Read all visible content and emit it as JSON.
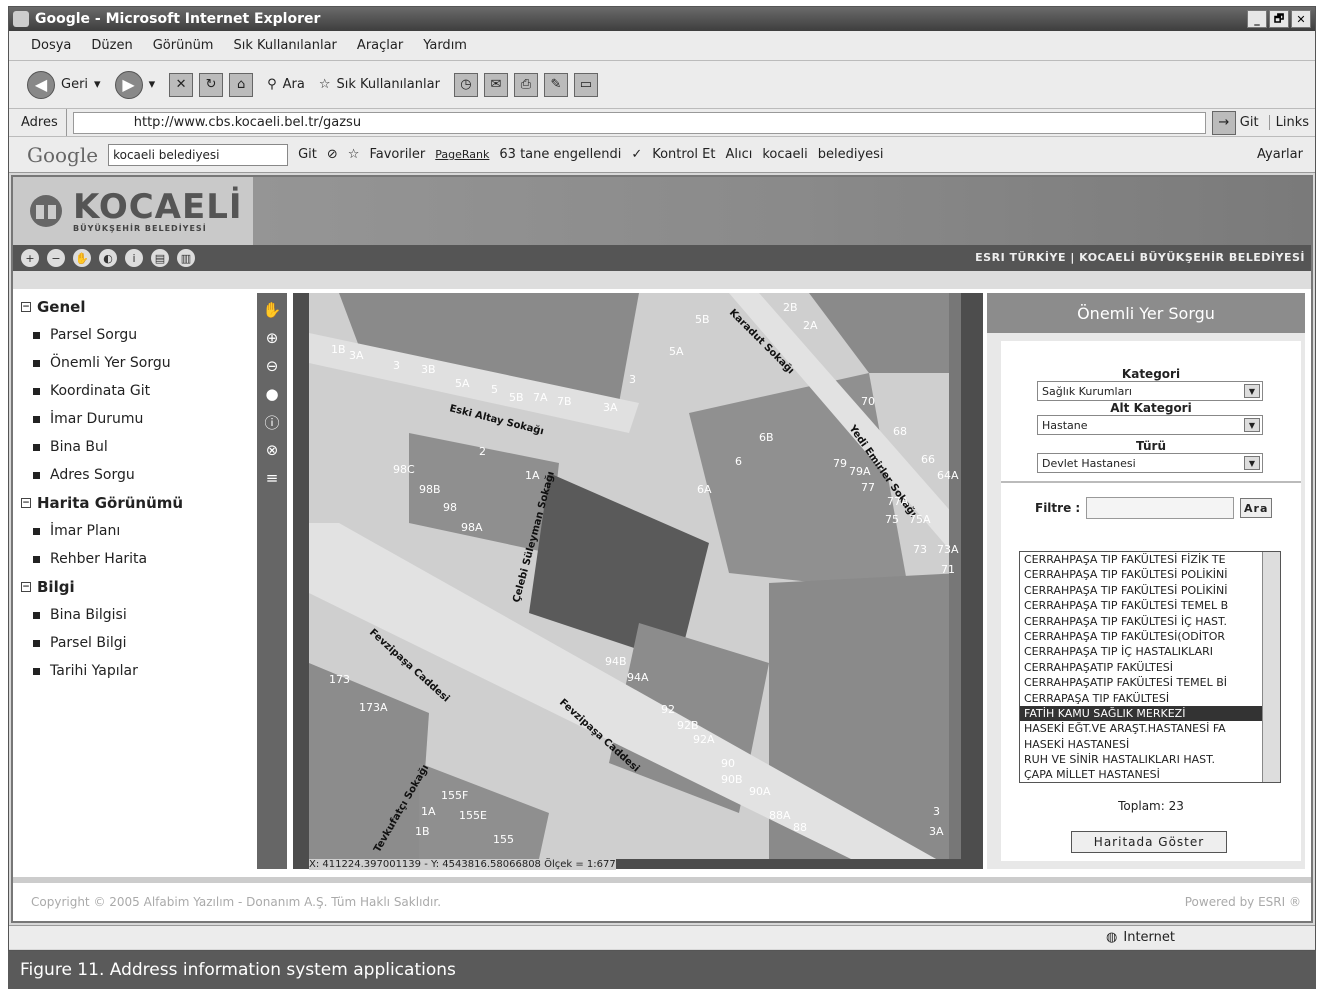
{
  "window": {
    "title": "Google - Microsoft Internet Explorer",
    "controls": [
      "_",
      "🗗",
      "✕"
    ]
  },
  "menu": [
    "Dosya",
    "Düzen",
    "Görünüm",
    "Sık Kullanılanlar",
    "Araçlar",
    "Yardım"
  ],
  "toolbar": {
    "back": "Geri",
    "search": "Ara",
    "favorites": "Sık Kullanılanlar"
  },
  "address": {
    "label": "Adres",
    "url": "http://www.cbs.kocaeli.bel.tr/gazsu",
    "go": "Git",
    "links": "Links"
  },
  "googlebar": {
    "brand": "Google",
    "query": "kocaeli belediyesi",
    "go": "Git",
    "favoriler": "Favoriler",
    "pagerank": "PageRank",
    "blocked": "63 tane engellendi",
    "spell": "Kontrol Et",
    "send": "Alıcı",
    "term1": "kocaeli",
    "term2": "belediyesi",
    "settings": "Ayarlar"
  },
  "site": {
    "logo": "KOCAELİ",
    "logo_sub": "BÜYÜKŞEHİR BELEDİYESİ",
    "credit": "ESRI TÜRKİYE | KOCAELİ BÜYÜKŞEHİR BELEDİYESİ"
  },
  "nav": {
    "genel": "Genel",
    "genel_items": [
      "Parsel Sorgu",
      "Önemli Yer Sorgu",
      "Koordinata Git",
      "İmar Durumu",
      "Bina Bul",
      "Adres Sorgu"
    ],
    "harita": "Harita Görünümü",
    "harita_items": [
      "İmar Planı",
      "Rehber Harita"
    ],
    "bilgi": "Bilgi",
    "bilgi_items": [
      "Bina Bilgisi",
      "Parsel Bilgi",
      "Tarihi Yapılar"
    ]
  },
  "map": {
    "streets": [
      "Karadut Sokağı",
      "Eski Altay Sokağı",
      "Yedi Emirler Sokağı",
      "Çelebi Süleyman Sokağı",
      "Fevzipaşa Caddesi",
      "Fevzipaşa Caddesi",
      "Tevkufatçı Sokağı"
    ],
    "labels": [
      "1B",
      "3A",
      "3",
      "3B",
      "5A",
      "5",
      "5B",
      "7A",
      "7B",
      "3A",
      "3",
      "5B",
      "5A",
      "2B",
      "2A",
      "2",
      "1A",
      "98C",
      "98B",
      "98",
      "98A",
      "6B",
      "6",
      "6A",
      "70",
      "68",
      "66",
      "64A",
      "79",
      "79A",
      "77",
      "77A",
      "75",
      "75A",
      "73",
      "73A",
      "71",
      "94B",
      "94A",
      "92",
      "92B",
      "92A",
      "90",
      "90B",
      "90A",
      "88A",
      "88",
      "173",
      "173A",
      "155F",
      "1A",
      "155E",
      "1B",
      "155",
      "3",
      "3A"
    ],
    "coords": "X: 411224.397001139 - Y: 4543816.58066808 Ölçek = 1:677"
  },
  "query": {
    "title": "Önemli Yer Sorgu",
    "kategori_label": "Kategori",
    "kategori": "Sağlık Kurumları",
    "alt_label": "Alt Kategori",
    "alt": "Hastane",
    "turu_label": "Türü",
    "turu": "Devlet Hastanesi",
    "filtre_label": "Filtre :",
    "ara": "Ara",
    "results": [
      "CERRAHPAŞA TIP FAKÜLTESİ FİZİK TE",
      "CERRAHPAŞA TIP FAKÜLTESİ POLİKİNİ",
      "CERRAHPAŞA TIP FAKÜLTESİ POLİKİNİ",
      "CERRAHPAŞA TIP FAKÜLTESİ TEMEL B",
      "CERRAHPAŞA TIP FAKÜLTESİ İÇ HAST.",
      "CERRAHPAŞA TIP FAKÜLTESİ(ODİTOR",
      "CERRAHPAŞA TIP İÇ HASTALIKLARI",
      "CERRAHPAŞATIP FAKÜLTESİ",
      "CERRAHPAŞATIP FAKÜLTESİ TEMEL Bİ",
      "CERRAPAŞA TIP FAKÜLTESİ",
      "FATİH KAMU SAĞLIK MERKEZİ",
      "HASEKİ EĞT.VE ARAŞT.HASTANESİ FA",
      "HASEKİ HASTANESİ",
      "RUH VE SİNİR HASTALIKLARI HAST.",
      "ÇAPA MİLLET HASTANESİ"
    ],
    "selected_index": 10,
    "toplam": "Toplam: 23",
    "show_btn": "Haritada Göster"
  },
  "footer": {
    "copyright": "Copyright © 2005 Alfabim Yazılım - Donanım A.Ş. Tüm Haklı Saklıdır.",
    "powered": "Powered by ESRI ®"
  },
  "status": {
    "zone": "Internet"
  },
  "caption": "Figure 11. Address information system applications"
}
